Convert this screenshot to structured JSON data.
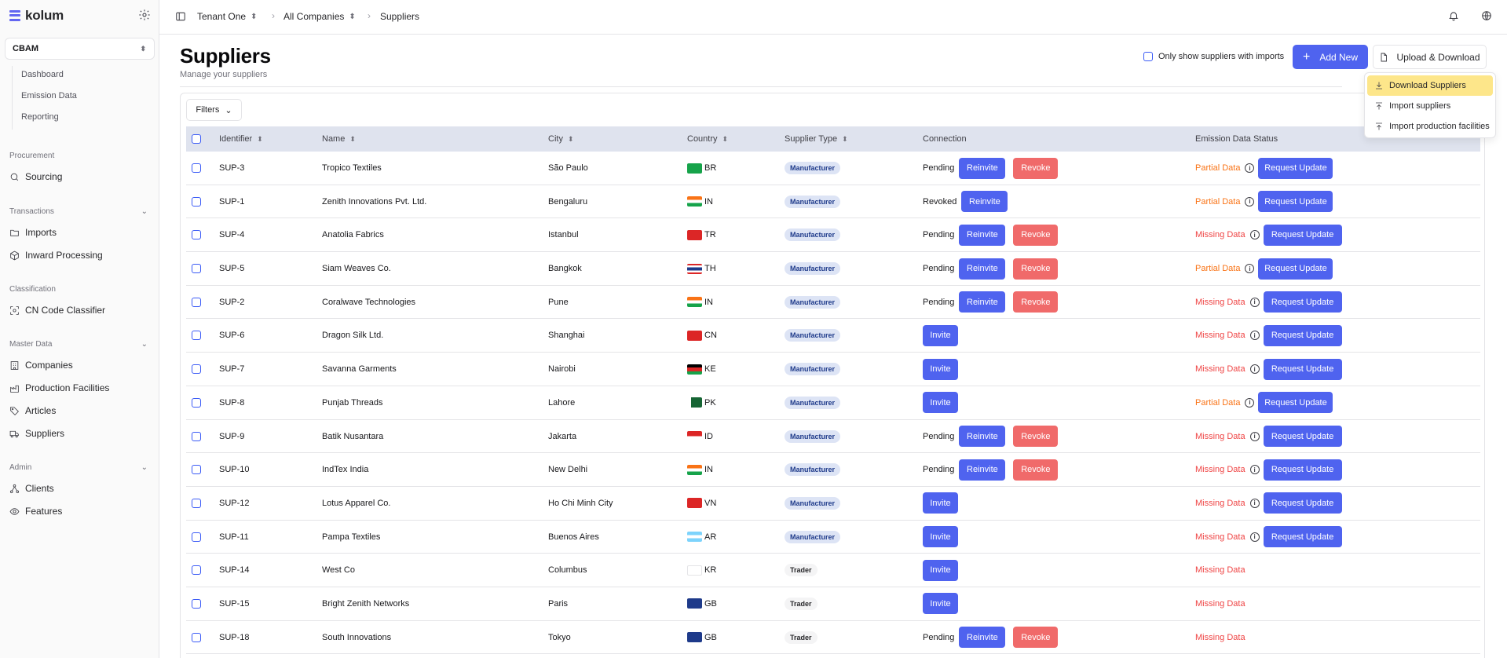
{
  "app": {
    "brand": "kolum"
  },
  "workspace": {
    "name": "CBAM"
  },
  "sidebar": {
    "sub_items": [
      "Dashboard",
      "Emission Data",
      "Reporting"
    ],
    "sections": {
      "procurement": "Procurement",
      "transactions": "Transactions",
      "classification": "Classification",
      "master_data": "Master Data",
      "admin": "Admin"
    },
    "items": {
      "sourcing": "Sourcing",
      "imports": "Imports",
      "inward": "Inward Processing",
      "cn_code": "CN Code Classifier",
      "companies": "Companies",
      "facilities": "Production Facilities",
      "articles": "Articles",
      "suppliers": "Suppliers",
      "clients": "Clients",
      "features": "Features"
    }
  },
  "breadcrumb": {
    "tenant": "Tenant One",
    "companies": "All Companies",
    "current": "Suppliers"
  },
  "header": {
    "title": "Suppliers",
    "subtitle": "Manage your suppliers",
    "only_show_label": "Only show suppliers with imports",
    "add_label": "Add New",
    "upload_label": "Upload & Download"
  },
  "dropdown": {
    "download": "Download Suppliers",
    "import_suppliers": "Import suppliers",
    "import_facilities": "Import production facilities"
  },
  "filters_label": "Filters",
  "table": {
    "columns": {
      "identifier": "Identifier",
      "name": "Name",
      "city": "City",
      "country": "Country",
      "type": "Supplier Type",
      "connection": "Connection",
      "status": "Emission Data Status"
    },
    "actions": {
      "reinvite": "Reinvite",
      "revoke": "Revoke",
      "invite": "Invite",
      "request": "Request Update"
    },
    "rows": [
      {
        "id": "SUP-3",
        "name": "Tropico Textiles",
        "city": "São Paulo",
        "country": "BR",
        "type": "Manufacturer",
        "conn": "Pending",
        "status": "Partial Data"
      },
      {
        "id": "SUP-1",
        "name": "Zenith Innovations Pvt. Ltd.",
        "city": "Bengaluru",
        "country": "IN",
        "type": "Manufacturer",
        "conn": "Revoked",
        "status": "Partial Data"
      },
      {
        "id": "SUP-4",
        "name": "Anatolia Fabrics",
        "city": "Istanbul",
        "country": "TR",
        "type": "Manufacturer",
        "conn": "Pending",
        "status": "Missing Data"
      },
      {
        "id": "SUP-5",
        "name": "Siam Weaves Co.",
        "city": "Bangkok",
        "country": "TH",
        "type": "Manufacturer",
        "conn": "Pending",
        "status": "Partial Data"
      },
      {
        "id": "SUP-2",
        "name": "Coralwave Technologies",
        "city": "Pune",
        "country": "IN",
        "type": "Manufacturer",
        "conn": "Pending",
        "status": "Missing Data"
      },
      {
        "id": "SUP-6",
        "name": "Dragon Silk Ltd.",
        "city": "Shanghai",
        "country": "CN",
        "type": "Manufacturer",
        "conn": "",
        "status": "Missing Data"
      },
      {
        "id": "SUP-7",
        "name": "Savanna Garments",
        "city": "Nairobi",
        "country": "KE",
        "type": "Manufacturer",
        "conn": "",
        "status": "Missing Data"
      },
      {
        "id": "SUP-8",
        "name": "Punjab Threads",
        "city": "Lahore",
        "country": "PK",
        "type": "Manufacturer",
        "conn": "",
        "status": "Partial Data"
      },
      {
        "id": "SUP-9",
        "name": "Batik Nusantara",
        "city": "Jakarta",
        "country": "ID",
        "type": "Manufacturer",
        "conn": "Pending",
        "status": "Missing Data"
      },
      {
        "id": "SUP-10",
        "name": "IndTex India",
        "city": "New Delhi",
        "country": "IN",
        "type": "Manufacturer",
        "conn": "Pending",
        "status": "Missing Data"
      },
      {
        "id": "SUP-12",
        "name": "Lotus Apparel Co.",
        "city": "Ho Chi Minh City",
        "country": "VN",
        "type": "Manufacturer",
        "conn": "",
        "status": "Missing Data"
      },
      {
        "id": "SUP-11",
        "name": "Pampa Textiles",
        "city": "Buenos Aires",
        "country": "AR",
        "type": "Manufacturer",
        "conn": "",
        "status": "Missing Data"
      },
      {
        "id": "SUP-14",
        "name": "West Co",
        "city": "Columbus",
        "country": "KR",
        "type": "Trader",
        "conn": "",
        "status": "Missing Data"
      },
      {
        "id": "SUP-15",
        "name": "Bright Zenith Networks",
        "city": "Paris",
        "country": "GB",
        "type": "Trader",
        "conn": "",
        "status": "Missing Data"
      },
      {
        "id": "SUP-18",
        "name": "South Innovations",
        "city": "Tokyo",
        "country": "GB",
        "type": "Trader",
        "conn": "Pending",
        "status": "Missing Data"
      }
    ]
  },
  "colors": {
    "primary": "#4f63ef",
    "danger": "#f06a6a",
    "partial": "#f97316",
    "missing": "#ef4444",
    "highlight": "#fde68a"
  }
}
